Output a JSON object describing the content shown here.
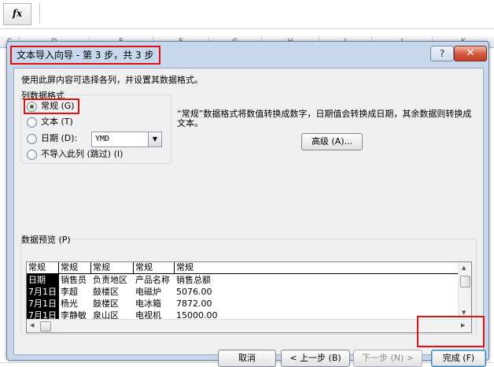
{
  "formula_bar": {
    "fx_label": "fx"
  },
  "sheet": {
    "columns": [
      "C",
      "D",
      "E",
      "F",
      "G",
      "H",
      "I",
      "J",
      "K"
    ]
  },
  "dialog": {
    "title": "文本导入向导 - 第 3 步，共 3 步",
    "help_label": "?",
    "close_label": "✕",
    "instruction": "使用此屏内容可选择各列，并设置其数据格式。",
    "group_title": "列数据格式",
    "radios": {
      "general": "常规 (G)",
      "text": "文本 (T)",
      "date": "日期 (D):",
      "skip": "不导入此列 (跳过) (I)"
    },
    "date_format": "YMD",
    "description": "“常规”数据格式将数值转换成数字，日期值会转换成日期，其余数据则转换成文本。",
    "advanced_button": "高级 (A)...",
    "preview_title": "数据预览 (P)",
    "preview": {
      "headers": [
        "常规",
        "常规",
        "常规",
        "常规",
        "常规"
      ],
      "rows": [
        [
          "日期",
          "销售员",
          "负责地区",
          "产品名称",
          "销售总额"
        ],
        [
          "7月1日",
          "李超",
          "鼓楼区",
          "电磁炉",
          "5076.00"
        ],
        [
          "7月1日",
          "杨光",
          "鼓楼区",
          "电冰箱",
          "7872.00"
        ],
        [
          "7月1日",
          "李静敏",
          "泉山区",
          "电视机",
          "15000.00"
        ]
      ]
    },
    "buttons": {
      "cancel": "取消",
      "back": "< 上一步 (B)",
      "next": "下一步 (N) >",
      "finish": "完成 (F)"
    }
  },
  "colors": {
    "highlight": "#e01010",
    "dialog_frame": "#c7d7ec",
    "close_button": "#c24129"
  }
}
